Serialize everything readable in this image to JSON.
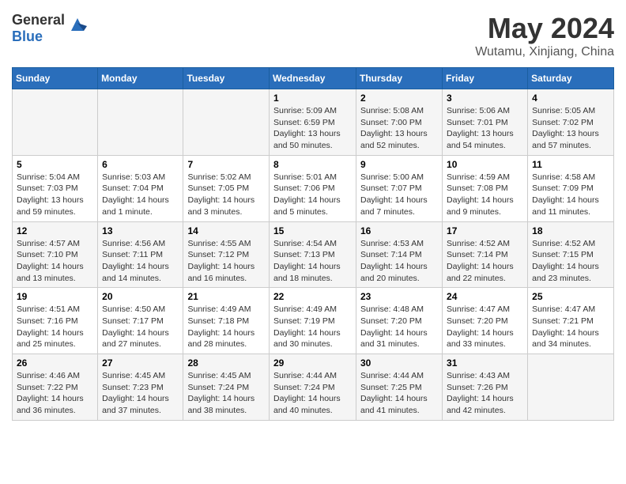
{
  "header": {
    "logo_general": "General",
    "logo_blue": "Blue",
    "month_year": "May 2024",
    "location": "Wutamu, Xinjiang, China"
  },
  "weekdays": [
    "Sunday",
    "Monday",
    "Tuesday",
    "Wednesday",
    "Thursday",
    "Friday",
    "Saturday"
  ],
  "weeks": [
    [
      {
        "day": "",
        "sunrise": "",
        "sunset": "",
        "daylight": ""
      },
      {
        "day": "",
        "sunrise": "",
        "sunset": "",
        "daylight": ""
      },
      {
        "day": "",
        "sunrise": "",
        "sunset": "",
        "daylight": ""
      },
      {
        "day": "1",
        "sunrise": "Sunrise: 5:09 AM",
        "sunset": "Sunset: 6:59 PM",
        "daylight": "Daylight: 13 hours and 50 minutes."
      },
      {
        "day": "2",
        "sunrise": "Sunrise: 5:08 AM",
        "sunset": "Sunset: 7:00 PM",
        "daylight": "Daylight: 13 hours and 52 minutes."
      },
      {
        "day": "3",
        "sunrise": "Sunrise: 5:06 AM",
        "sunset": "Sunset: 7:01 PM",
        "daylight": "Daylight: 13 hours and 54 minutes."
      },
      {
        "day": "4",
        "sunrise": "Sunrise: 5:05 AM",
        "sunset": "Sunset: 7:02 PM",
        "daylight": "Daylight: 13 hours and 57 minutes."
      }
    ],
    [
      {
        "day": "5",
        "sunrise": "Sunrise: 5:04 AM",
        "sunset": "Sunset: 7:03 PM",
        "daylight": "Daylight: 13 hours and 59 minutes."
      },
      {
        "day": "6",
        "sunrise": "Sunrise: 5:03 AM",
        "sunset": "Sunset: 7:04 PM",
        "daylight": "Daylight: 14 hours and 1 minute."
      },
      {
        "day": "7",
        "sunrise": "Sunrise: 5:02 AM",
        "sunset": "Sunset: 7:05 PM",
        "daylight": "Daylight: 14 hours and 3 minutes."
      },
      {
        "day": "8",
        "sunrise": "Sunrise: 5:01 AM",
        "sunset": "Sunset: 7:06 PM",
        "daylight": "Daylight: 14 hours and 5 minutes."
      },
      {
        "day": "9",
        "sunrise": "Sunrise: 5:00 AM",
        "sunset": "Sunset: 7:07 PM",
        "daylight": "Daylight: 14 hours and 7 minutes."
      },
      {
        "day": "10",
        "sunrise": "Sunrise: 4:59 AM",
        "sunset": "Sunset: 7:08 PM",
        "daylight": "Daylight: 14 hours and 9 minutes."
      },
      {
        "day": "11",
        "sunrise": "Sunrise: 4:58 AM",
        "sunset": "Sunset: 7:09 PM",
        "daylight": "Daylight: 14 hours and 11 minutes."
      }
    ],
    [
      {
        "day": "12",
        "sunrise": "Sunrise: 4:57 AM",
        "sunset": "Sunset: 7:10 PM",
        "daylight": "Daylight: 14 hours and 13 minutes."
      },
      {
        "day": "13",
        "sunrise": "Sunrise: 4:56 AM",
        "sunset": "Sunset: 7:11 PM",
        "daylight": "Daylight: 14 hours and 14 minutes."
      },
      {
        "day": "14",
        "sunrise": "Sunrise: 4:55 AM",
        "sunset": "Sunset: 7:12 PM",
        "daylight": "Daylight: 14 hours and 16 minutes."
      },
      {
        "day": "15",
        "sunrise": "Sunrise: 4:54 AM",
        "sunset": "Sunset: 7:13 PM",
        "daylight": "Daylight: 14 hours and 18 minutes."
      },
      {
        "day": "16",
        "sunrise": "Sunrise: 4:53 AM",
        "sunset": "Sunset: 7:14 PM",
        "daylight": "Daylight: 14 hours and 20 minutes."
      },
      {
        "day": "17",
        "sunrise": "Sunrise: 4:52 AM",
        "sunset": "Sunset: 7:14 PM",
        "daylight": "Daylight: 14 hours and 22 minutes."
      },
      {
        "day": "18",
        "sunrise": "Sunrise: 4:52 AM",
        "sunset": "Sunset: 7:15 PM",
        "daylight": "Daylight: 14 hours and 23 minutes."
      }
    ],
    [
      {
        "day": "19",
        "sunrise": "Sunrise: 4:51 AM",
        "sunset": "Sunset: 7:16 PM",
        "daylight": "Daylight: 14 hours and 25 minutes."
      },
      {
        "day": "20",
        "sunrise": "Sunrise: 4:50 AM",
        "sunset": "Sunset: 7:17 PM",
        "daylight": "Daylight: 14 hours and 27 minutes."
      },
      {
        "day": "21",
        "sunrise": "Sunrise: 4:49 AM",
        "sunset": "Sunset: 7:18 PM",
        "daylight": "Daylight: 14 hours and 28 minutes."
      },
      {
        "day": "22",
        "sunrise": "Sunrise: 4:49 AM",
        "sunset": "Sunset: 7:19 PM",
        "daylight": "Daylight: 14 hours and 30 minutes."
      },
      {
        "day": "23",
        "sunrise": "Sunrise: 4:48 AM",
        "sunset": "Sunset: 7:20 PM",
        "daylight": "Daylight: 14 hours and 31 minutes."
      },
      {
        "day": "24",
        "sunrise": "Sunrise: 4:47 AM",
        "sunset": "Sunset: 7:20 PM",
        "daylight": "Daylight: 14 hours and 33 minutes."
      },
      {
        "day": "25",
        "sunrise": "Sunrise: 4:47 AM",
        "sunset": "Sunset: 7:21 PM",
        "daylight": "Daylight: 14 hours and 34 minutes."
      }
    ],
    [
      {
        "day": "26",
        "sunrise": "Sunrise: 4:46 AM",
        "sunset": "Sunset: 7:22 PM",
        "daylight": "Daylight: 14 hours and 36 minutes."
      },
      {
        "day": "27",
        "sunrise": "Sunrise: 4:45 AM",
        "sunset": "Sunset: 7:23 PM",
        "daylight": "Daylight: 14 hours and 37 minutes."
      },
      {
        "day": "28",
        "sunrise": "Sunrise: 4:45 AM",
        "sunset": "Sunset: 7:24 PM",
        "daylight": "Daylight: 14 hours and 38 minutes."
      },
      {
        "day": "29",
        "sunrise": "Sunrise: 4:44 AM",
        "sunset": "Sunset: 7:24 PM",
        "daylight": "Daylight: 14 hours and 40 minutes."
      },
      {
        "day": "30",
        "sunrise": "Sunrise: 4:44 AM",
        "sunset": "Sunset: 7:25 PM",
        "daylight": "Daylight: 14 hours and 41 minutes."
      },
      {
        "day": "31",
        "sunrise": "Sunrise: 4:43 AM",
        "sunset": "Sunset: 7:26 PM",
        "daylight": "Daylight: 14 hours and 42 minutes."
      },
      {
        "day": "",
        "sunrise": "",
        "sunset": "",
        "daylight": ""
      }
    ]
  ]
}
